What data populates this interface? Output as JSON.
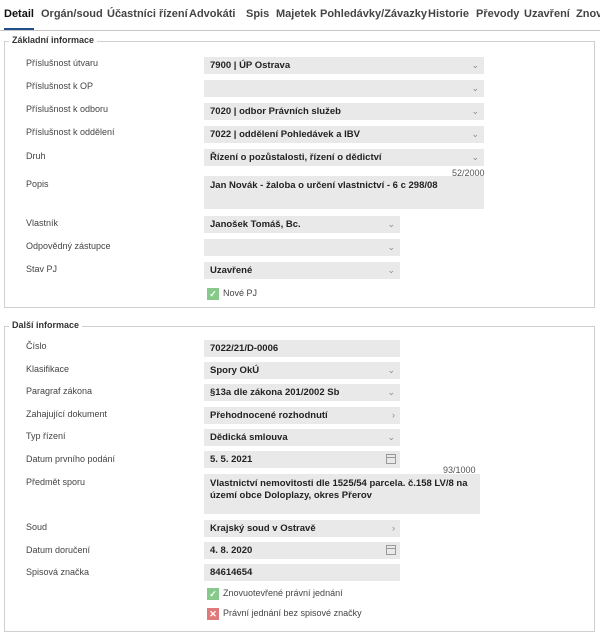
{
  "tabs": [
    {
      "label": "Detail",
      "active": true
    },
    {
      "label": "Orgán/soud"
    },
    {
      "label": "Účastníci řízení"
    },
    {
      "label": "Advokáti"
    },
    {
      "label": "Spis"
    },
    {
      "label": "Majetek"
    },
    {
      "label": "Pohledávky/Závazky"
    },
    {
      "label": "Historie"
    },
    {
      "label": "Převody"
    },
    {
      "label": "Uzavření"
    },
    {
      "label": "Znov"
    }
  ],
  "basic": {
    "title": "Základní informace",
    "fields": [
      {
        "label": "Příslušnost útvaru",
        "value": "7900 | ÚP Ostrava"
      },
      {
        "label": "Příslušnost k OP",
        "value": ""
      },
      {
        "label": "Příslušnost k odboru",
        "value": "7020 | odbor Právních služeb"
      },
      {
        "label": "Příslušnost k oddělení",
        "value": "7022 | oddělení Pohledávek a IBV"
      },
      {
        "label": "Druh",
        "value": "Řízení o pozůstalosti, řízení o dědictví"
      },
      {
        "label": "Popis",
        "value": "Jan Novák - žaloba o určení vlastnictví - 6 c 298/08",
        "counter": "52/2000"
      },
      {
        "label": "Vlastník",
        "value": "Janošek Tomáš, Bc."
      },
      {
        "label": "Odpovědný zástupce",
        "value": ""
      },
      {
        "label": "Stav PJ",
        "value": "Uzavřené"
      }
    ],
    "checkbox": {
      "label": "Nové PJ",
      "checked": true
    }
  },
  "more": {
    "title": "Další informace",
    "fields": [
      {
        "label": "Číslo",
        "value": "7022/21/D-0006"
      },
      {
        "label": "Klasifikace",
        "value": "Spory OkÚ"
      },
      {
        "label": "Paragraf zákona",
        "value": "§13a dle zákona 201/2002 Sb"
      },
      {
        "label": "Zahajující dokument",
        "value": "Přehodnocené rozhodnutí"
      },
      {
        "label": "Typ řízení",
        "value": "Dědická smlouva"
      },
      {
        "label": "Datum prvního podání",
        "value": "5. 5. 2021"
      },
      {
        "label": "Předmět sporu",
        "value": "Vlastnictví nemovitosti dle 1525/54 parcela. č.158 LV/8 na území obce Doloplazy, okres Přerov",
        "counter": "93/1000"
      },
      {
        "label": "Soud",
        "value": "Krajský soud v Ostravě"
      },
      {
        "label": "Datum doručení",
        "value": "4. 8. 2020"
      },
      {
        "label": "Spisová značka",
        "value": "84614654"
      }
    ],
    "checkboxes": [
      {
        "label": "Znovuotevřené právní jednání",
        "checked": true
      },
      {
        "label": "Právní jednání bez spisové značky",
        "checked": false
      }
    ]
  }
}
